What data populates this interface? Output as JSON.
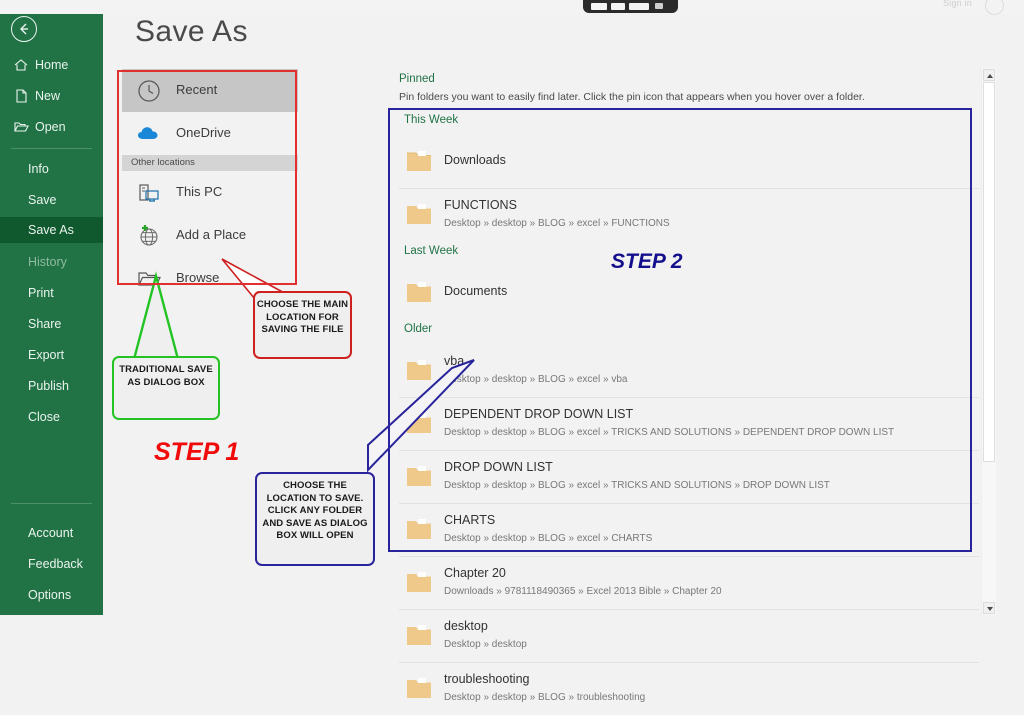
{
  "window": {
    "signin_label": "Sign in",
    "brand_color": "#217346"
  },
  "header": {
    "title": "Save As"
  },
  "nav": {
    "back_icon": "back-arrow-icon",
    "items": [
      {
        "label": "Home",
        "icon": "home-icon",
        "state": "normal"
      },
      {
        "label": "New",
        "icon": "new-doc-icon",
        "state": "normal"
      },
      {
        "label": "Open",
        "icon": "open-folder-icon",
        "state": "normal"
      },
      {
        "label": "Info",
        "icon": "",
        "state": "normal"
      },
      {
        "label": "Save",
        "icon": "",
        "state": "normal"
      },
      {
        "label": "Save As",
        "icon": "",
        "state": "active"
      },
      {
        "label": "History",
        "icon": "",
        "state": "disabled"
      },
      {
        "label": "Print",
        "icon": "",
        "state": "normal"
      },
      {
        "label": "Share",
        "icon": "",
        "state": "normal"
      },
      {
        "label": "Export",
        "icon": "",
        "state": "normal"
      },
      {
        "label": "Publish",
        "icon": "",
        "state": "normal"
      },
      {
        "label": "Close",
        "icon": "",
        "state": "normal"
      },
      {
        "label": "Account",
        "icon": "",
        "state": "normal"
      },
      {
        "label": "Feedback",
        "icon": "",
        "state": "normal"
      },
      {
        "label": "Options",
        "icon": "",
        "state": "normal"
      }
    ]
  },
  "places": {
    "recent": {
      "label": "Recent",
      "icon": "clock-icon",
      "selected": true
    },
    "onedrive": {
      "label": "OneDrive",
      "icon": "cloud-icon"
    },
    "other_locations_header": "Other locations",
    "thispc": {
      "label": "This PC",
      "icon": "computer-icon"
    },
    "addplace": {
      "label": "Add a Place",
      "icon": "globe-plus-icon"
    },
    "browse": {
      "label": "Browse",
      "icon": "folder-open-icon"
    }
  },
  "pinned": {
    "title": "Pinned",
    "hint": "Pin folders you want to easily find later. Click the pin icon that appears when you hover over a folder."
  },
  "groups": [
    {
      "label": "This Week",
      "items": [
        {
          "name": "Downloads",
          "path": ""
        },
        {
          "name": "FUNCTIONS",
          "path": "Desktop » desktop » BLOG » excel » FUNCTIONS"
        }
      ]
    },
    {
      "label": "Last Week",
      "items": [
        {
          "name": "Documents",
          "path": ""
        }
      ]
    },
    {
      "label": "Older",
      "items": [
        {
          "name": "vba",
          "path": "Desktop » desktop » BLOG » excel » vba"
        },
        {
          "name": "DEPENDENT DROP DOWN LIST",
          "path": "Desktop » desktop » BLOG » excel » TRICKS AND SOLUTIONS » DEPENDENT DROP DOWN LIST"
        },
        {
          "name": "DROP DOWN LIST",
          "path": "Desktop » desktop » BLOG » excel » TRICKS AND SOLUTIONS » DROP DOWN LIST"
        },
        {
          "name": "CHARTS",
          "path": "Desktop » desktop » BLOG » excel » CHARTS"
        },
        {
          "name": "Chapter 20",
          "path": "Downloads » 9781118490365 » Excel 2013 Bible » Chapter 20"
        },
        {
          "name": "desktop",
          "path": "Desktop » desktop"
        },
        {
          "name": "troubleshooting",
          "path": "Desktop » desktop » BLOG » troubleshooting"
        }
      ]
    }
  ],
  "annotations": {
    "step1": "STEP 1",
    "step2": "STEP 2",
    "callout_red": "CHOOSE THE MAIN LOCATION FOR SAVING THE FILE",
    "callout_green": "TRADITIONAL SAVE AS DIALOG BOX",
    "callout_navy": "CHOOSE THE LOCATION TO SAVE. CLICK ANY FOLDER AND SAVE AS DIALOG BOX WILL OPEN",
    "colors": {
      "red": "#e03030",
      "green": "#22c322",
      "navy": "#2a249c",
      "step1_text": "#f00a0a",
      "step2_text": "#140f8c"
    }
  }
}
